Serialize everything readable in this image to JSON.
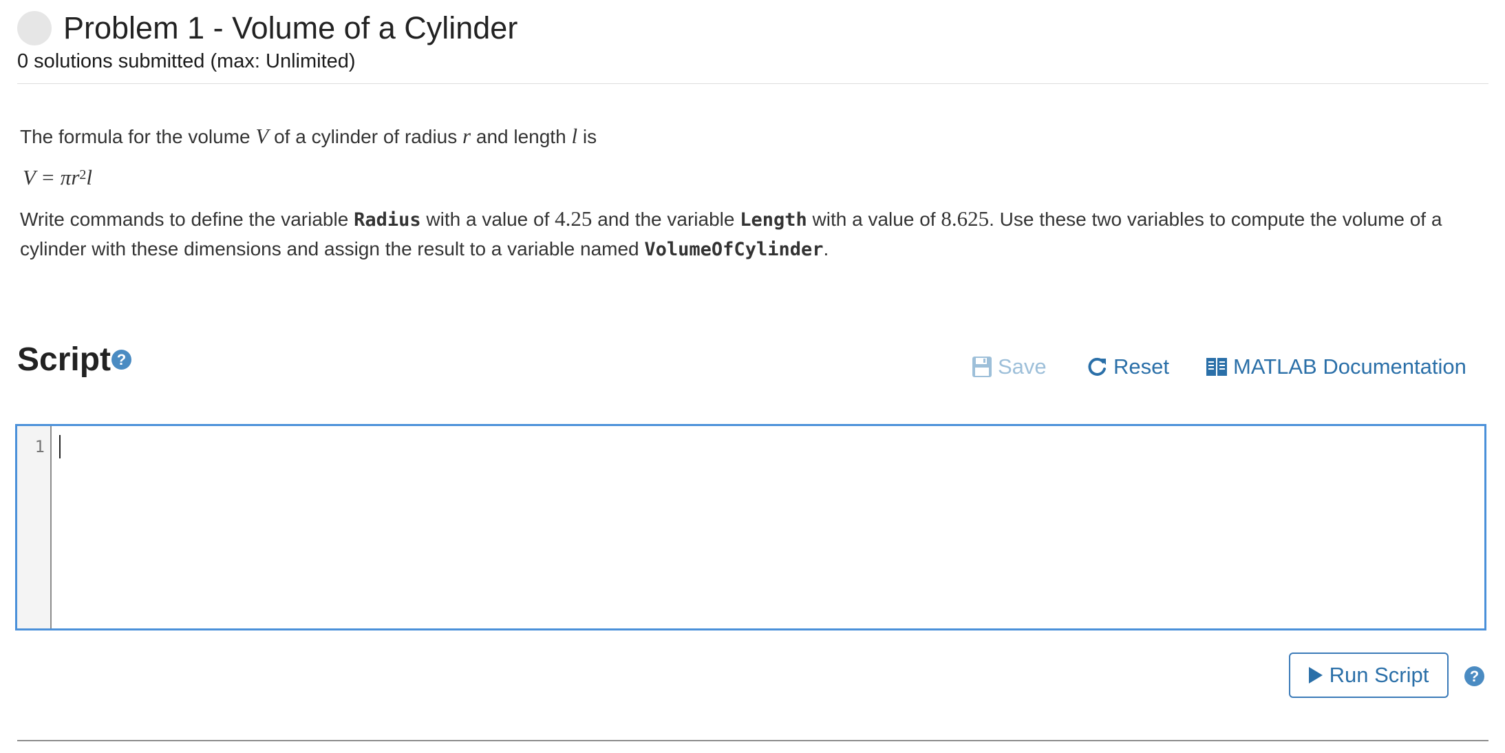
{
  "problem": {
    "title": "Problem 1 - Volume of a Cylinder",
    "submissions": "0 solutions submitted (max: Unlimited)"
  },
  "description": {
    "p1_a": "The formula for the volume",
    "p1_V": "V",
    "p1_b": "of a cylinder of radius",
    "p1_r": "r",
    "p1_c": "and length",
    "p1_l": "l",
    "p1_d": "is",
    "formula_lhs": "V = πr",
    "formula_exp": "2",
    "formula_rhs": "l",
    "p2_a": "Write commands to define the variable ",
    "var_radius": "Radius",
    "p2_b": " with a value of ",
    "val_radius": "4.25",
    "p2_c": " and the variable ",
    "var_length": "Length",
    "p2_d": " with a value of ",
    "val_length": "8.625",
    "p2_e": ". Use these two variables to compute the volume of a cylinder with these dimensions and assign the result to a variable named ",
    "var_volume": "VolumeOfCylinder",
    "p2_f": "."
  },
  "script": {
    "heading": "Script",
    "help_glyph": "?",
    "save_label": "Save",
    "reset_label": "Reset",
    "docs_label": "MATLAB Documentation",
    "line_number": "1",
    "code": ""
  },
  "actions": {
    "run_label": "Run Script",
    "help_glyph": "?"
  },
  "colors": {
    "accent": "#2a6fa8",
    "editor_border": "#4a90d9",
    "save_disabled": "#9dbfd9",
    "help_icon": "#4a8bc2"
  },
  "icons": {
    "save": "floppy-disk-icon",
    "reset": "refresh-icon",
    "docs": "book-icon",
    "run": "play-icon",
    "help": "question-circle-icon"
  }
}
